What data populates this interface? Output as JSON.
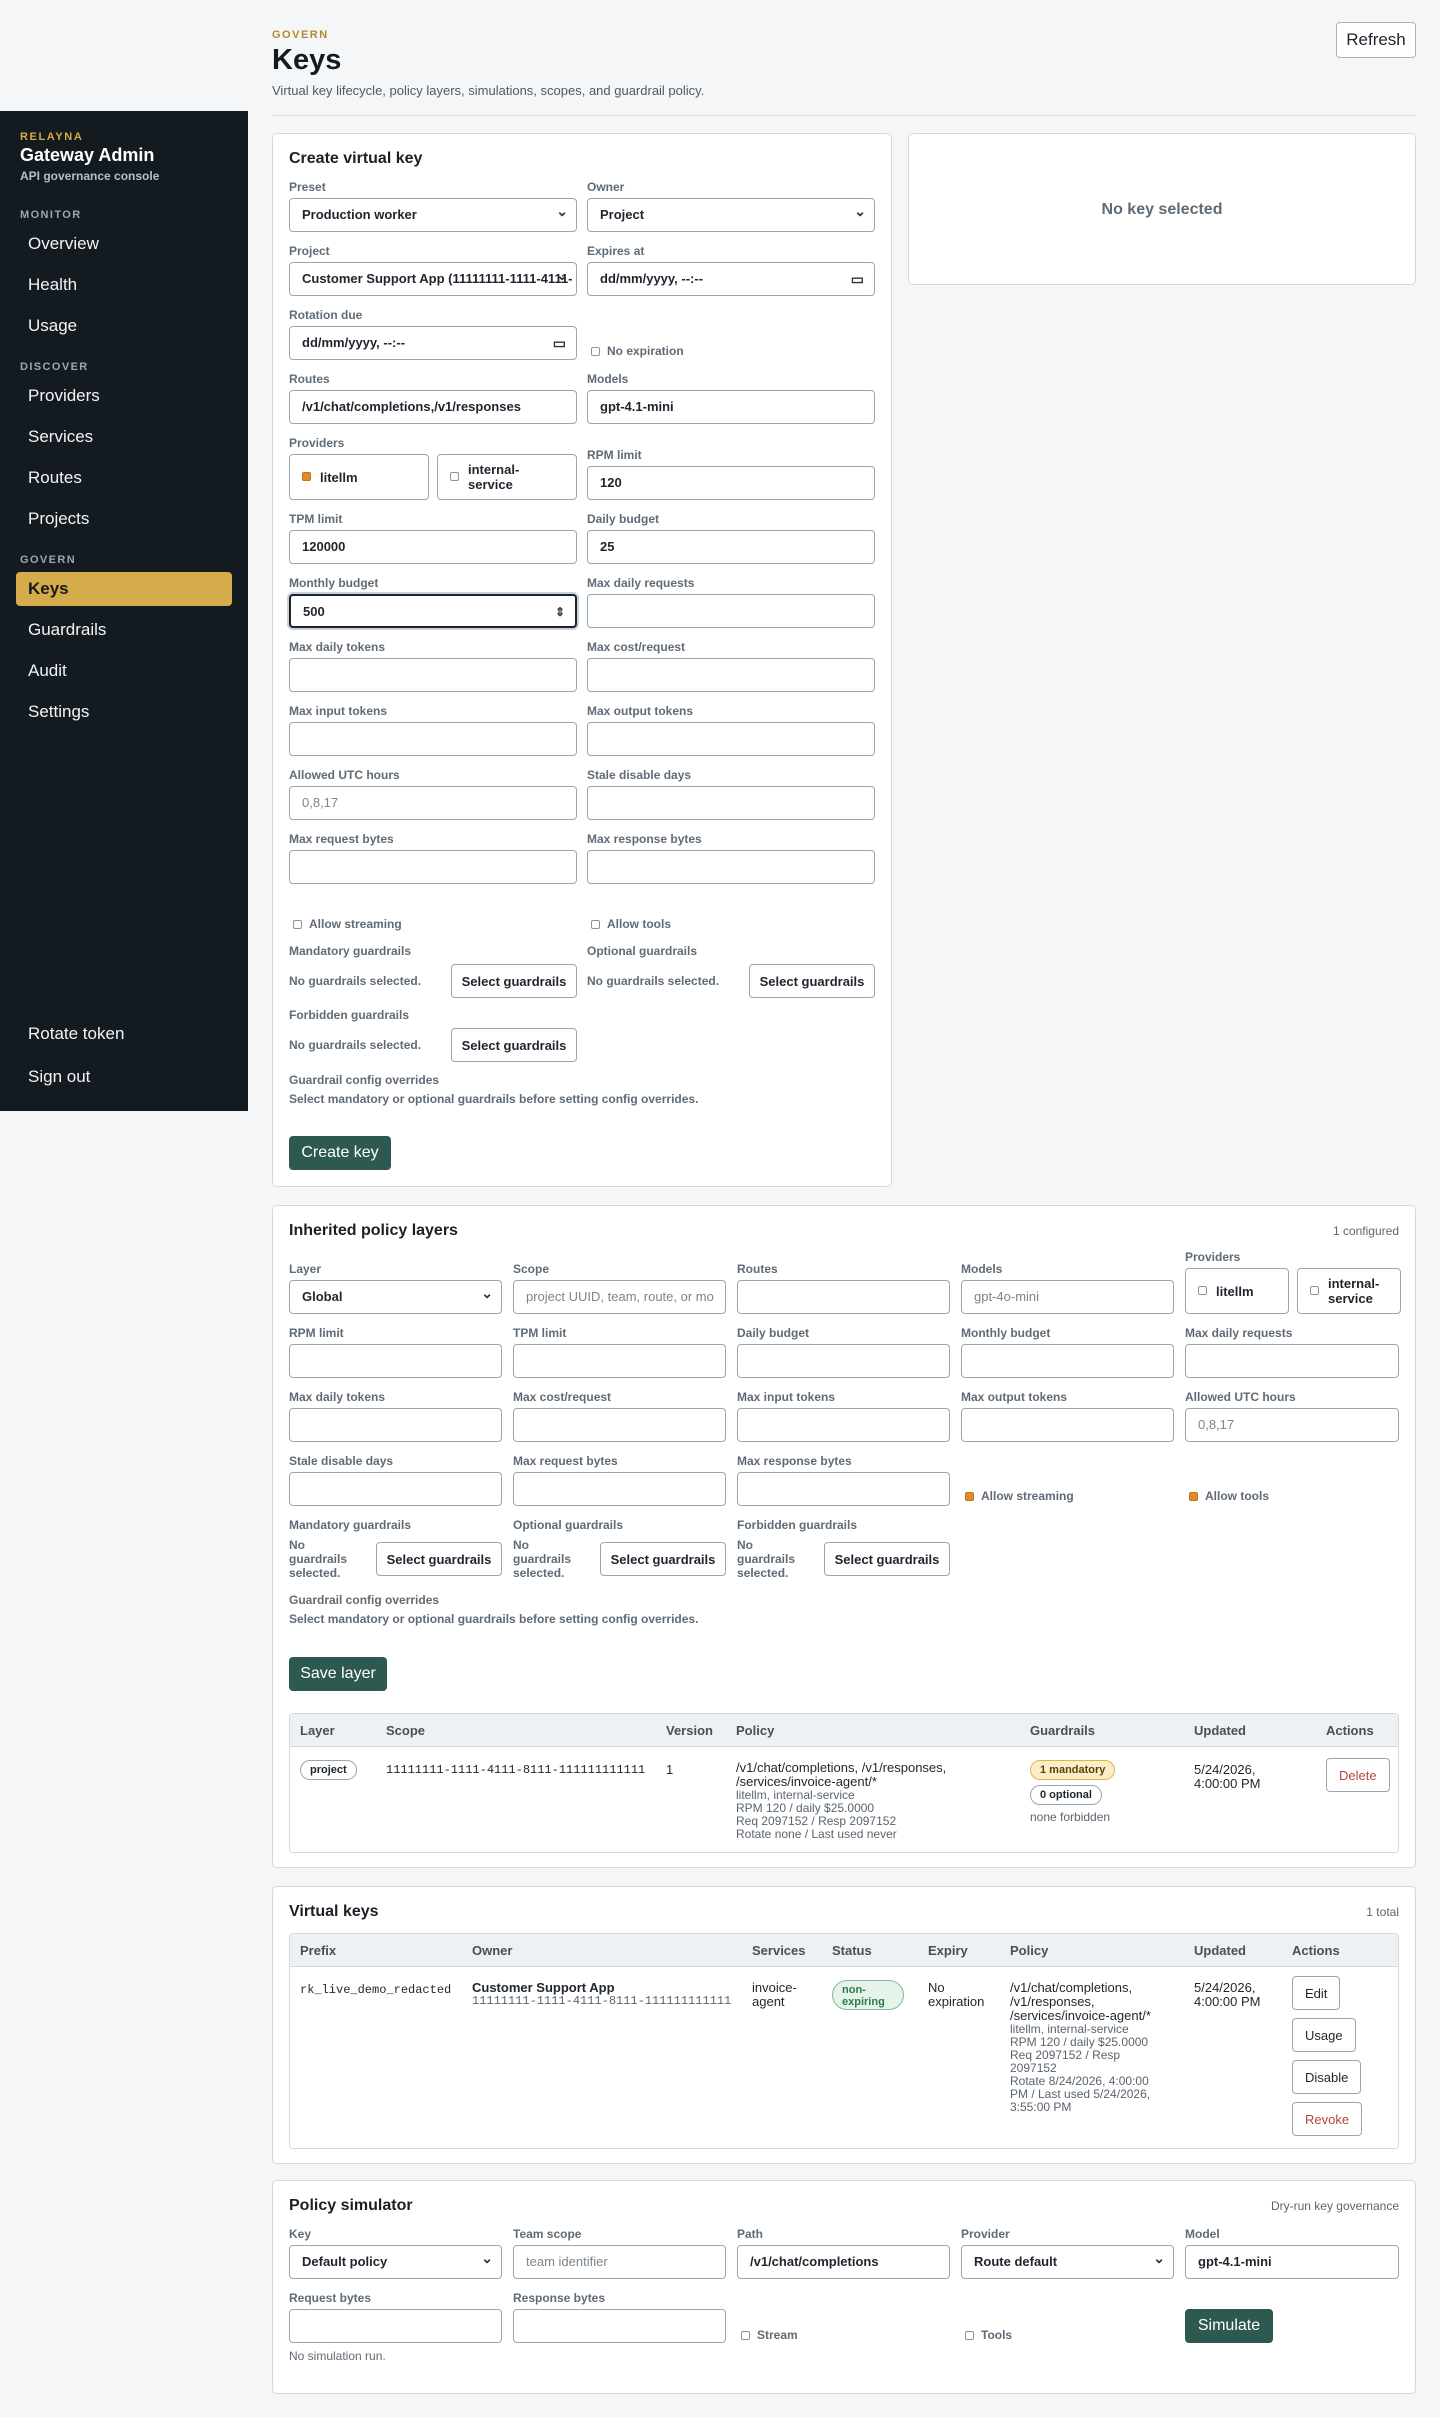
{
  "sidebar": {
    "brand_tag": "RELAYNA",
    "brand_title": "Gateway Admin",
    "brand_sub": "API governance console",
    "sections": {
      "monitor": "MONITOR",
      "discover": "DISCOVER",
      "govern": "GOVERN"
    },
    "items": {
      "overview": "Overview",
      "health": "Health",
      "usage": "Usage",
      "providers": "Providers",
      "services": "Services",
      "routes": "Routes",
      "projects": "Projects",
      "keys": "Keys",
      "guardrails": "Guardrails",
      "audit": "Audit",
      "settings": "Settings",
      "rotate_token": "Rotate token",
      "sign_out": "Sign out"
    }
  },
  "header": {
    "tag": "GOVERN",
    "title": "Keys",
    "subtitle": "Virtual key lifecycle, policy layers, simulations, scopes, and guardrail policy.",
    "refresh": "Refresh"
  },
  "create": {
    "title": "Create virtual key",
    "preset_label": "Preset",
    "preset_value": "Production worker",
    "owner_label": "Owner",
    "owner_value": "Project",
    "project_label": "Project",
    "project_value": "Customer Support App (11111111-1111-4111-",
    "expires_label": "Expires at",
    "expires_value": "dd/mm/yyyy, --:--",
    "rotation_label": "Rotation due",
    "rotation_value": "dd/mm/yyyy, --:--",
    "no_expiration": "No expiration",
    "routes_label": "Routes",
    "routes_value": "/v1/chat/completions,/v1/responses",
    "models_label": "Models",
    "models_value": "gpt-4.1-mini",
    "providers_label": "Providers",
    "provider_litellm": "litellm",
    "provider_internal": "internal-service",
    "rpm_label": "RPM limit",
    "rpm_value": "120",
    "tpm_label": "TPM limit",
    "tpm_value": "120000",
    "daily_budget_label": "Daily budget",
    "daily_budget_value": "25",
    "monthly_budget_label": "Monthly budget",
    "monthly_budget_value": "500",
    "max_daily_requests_label": "Max daily requests",
    "max_daily_tokens_label": "Max daily tokens",
    "max_cost_label": "Max cost/request",
    "max_input_label": "Max input tokens",
    "max_output_label": "Max output tokens",
    "allowed_hours_label": "Allowed UTC hours",
    "allowed_hours_value": "0,8,17",
    "stale_label": "Stale disable days",
    "max_req_bytes_label": "Max request bytes",
    "max_resp_bytes_label": "Max response bytes",
    "allow_streaming": "Allow streaming",
    "allow_tools": "Allow tools",
    "mandatory_label": "Mandatory guardrails",
    "optional_label": "Optional guardrails",
    "forbidden_label": "Forbidden guardrails",
    "none_selected": "No guardrails selected.",
    "select_guardrails": "Select guardrails",
    "overrides_label": "Guardrail config overrides",
    "overrides_note": "Select mandatory or optional guardrails before setting config overrides.",
    "create_btn": "Create key"
  },
  "detail": {
    "empty": "No key selected"
  },
  "layers": {
    "title": "Inherited policy layers",
    "count": "1 configured",
    "layer_label": "Layer",
    "layer_value": "Global",
    "scope_label": "Scope",
    "scope_placeholder": "project UUID, team, route, or mo",
    "routes_label": "Routes",
    "models_label": "Models",
    "models_placeholder": "gpt-4o-mini",
    "providers_label": "Providers",
    "provider_litellm": "litellm",
    "provider_internal": "internal-service",
    "rpm_label": "RPM limit",
    "tpm_label": "TPM limit",
    "daily_budget_label": "Daily budget",
    "monthly_budget_label": "Monthly budget",
    "max_daily_requests_label": "Max daily requests",
    "max_daily_tokens_label": "Max daily tokens",
    "max_cost_label": "Max cost/request",
    "max_input_label": "Max input tokens",
    "max_output_label": "Max output tokens",
    "allowed_hours_label": "Allowed UTC hours",
    "allowed_hours_placeholder": "0,8,17",
    "stale_label": "Stale disable days",
    "max_req_bytes_label": "Max request bytes",
    "max_resp_bytes_label": "Max response bytes",
    "allow_streaming": "Allow streaming",
    "allow_tools": "Allow tools",
    "mandatory_label": "Mandatory guardrails",
    "optional_label": "Optional guardrails",
    "forbidden_label": "Forbidden guardrails",
    "none_line1": "No",
    "none_line2": "guardrails",
    "none_line3": "selected.",
    "select_guardrails": "Select guardrails",
    "overrides_label": "Guardrail config overrides",
    "overrides_note": "Select mandatory or optional guardrails before setting config overrides.",
    "save_btn": "Save layer",
    "table": {
      "headers": [
        "Layer",
        "Scope",
        "Version",
        "Policy",
        "Guardrails",
        "Updated",
        "Actions"
      ],
      "row": {
        "layer": "project",
        "scope": "11111111-1111-4111-8111-111111111111",
        "version": "1",
        "policy_main_1": "/v1/chat/completions, /v1/responses,",
        "policy_main_2": "/services/invoice-agent/*",
        "policy_l1": "litellm, internal-service",
        "policy_l2": "RPM 120 / daily $25.0000",
        "policy_l3": "Req 2097152 / Resp 2097152",
        "policy_l4": "Rotate none / Last used never",
        "g_mandatory": "1 mandatory",
        "g_optional": "0 optional",
        "g_forbidden": "none forbidden",
        "updated_1": "5/24/2026,",
        "updated_2": "4:00:00 PM",
        "delete": "Delete"
      }
    }
  },
  "vkeys": {
    "title": "Virtual keys",
    "count": "1 total",
    "headers": [
      "Prefix",
      "Owner",
      "Services",
      "Status",
      "Expiry",
      "Policy",
      "Updated",
      "Actions"
    ],
    "row": {
      "prefix": "rk_live_demo_redacted",
      "owner_name": "Customer Support App",
      "owner_id": "11111111-1111-4111-8111-111111111111",
      "services_1": "invoice-",
      "services_2": "agent",
      "status_1": "non-",
      "status_2": "expiring",
      "expiry_1": "No",
      "expiry_2": "expiration",
      "policy_1": "/v1/chat/completions,",
      "policy_2": "/v1/responses,",
      "policy_3": "/services/invoice-agent/*",
      "policy_s1": "litellm, internal-service",
      "policy_s2": "RPM 120 / daily $25.0000",
      "policy_s3": "Req 2097152 / Resp",
      "policy_s4": "2097152",
      "policy_s5": "Rotate 8/24/2026, 4:00:00",
      "policy_s6": "PM / Last used 5/24/2026,",
      "policy_s7": "3:55:00 PM",
      "updated_1": "5/24/2026,",
      "updated_2": "4:00:00 PM",
      "edit": "Edit",
      "usage": "Usage",
      "disable": "Disable",
      "revoke": "Revoke"
    }
  },
  "simulator": {
    "title": "Policy simulator",
    "subtitle": "Dry-run key governance",
    "key_label": "Key",
    "key_value": "Default policy",
    "team_label": "Team scope",
    "team_placeholder": "team identifier",
    "path_label": "Path",
    "path_value": "/v1/chat/completions",
    "provider_label": "Provider",
    "provider_value": "Route default",
    "model_label": "Model",
    "model_value": "gpt-4.1-mini",
    "req_bytes_label": "Request bytes",
    "resp_bytes_label": "Response bytes",
    "stream": "Stream",
    "tools": "Tools",
    "simulate": "Simulate",
    "no_run": "No simulation run."
  },
  "colors": {
    "sidebar_bg": "#131a20",
    "accent": "#d5ab4c",
    "primary_btn": "#2d5950",
    "danger": "#b5463a"
  }
}
